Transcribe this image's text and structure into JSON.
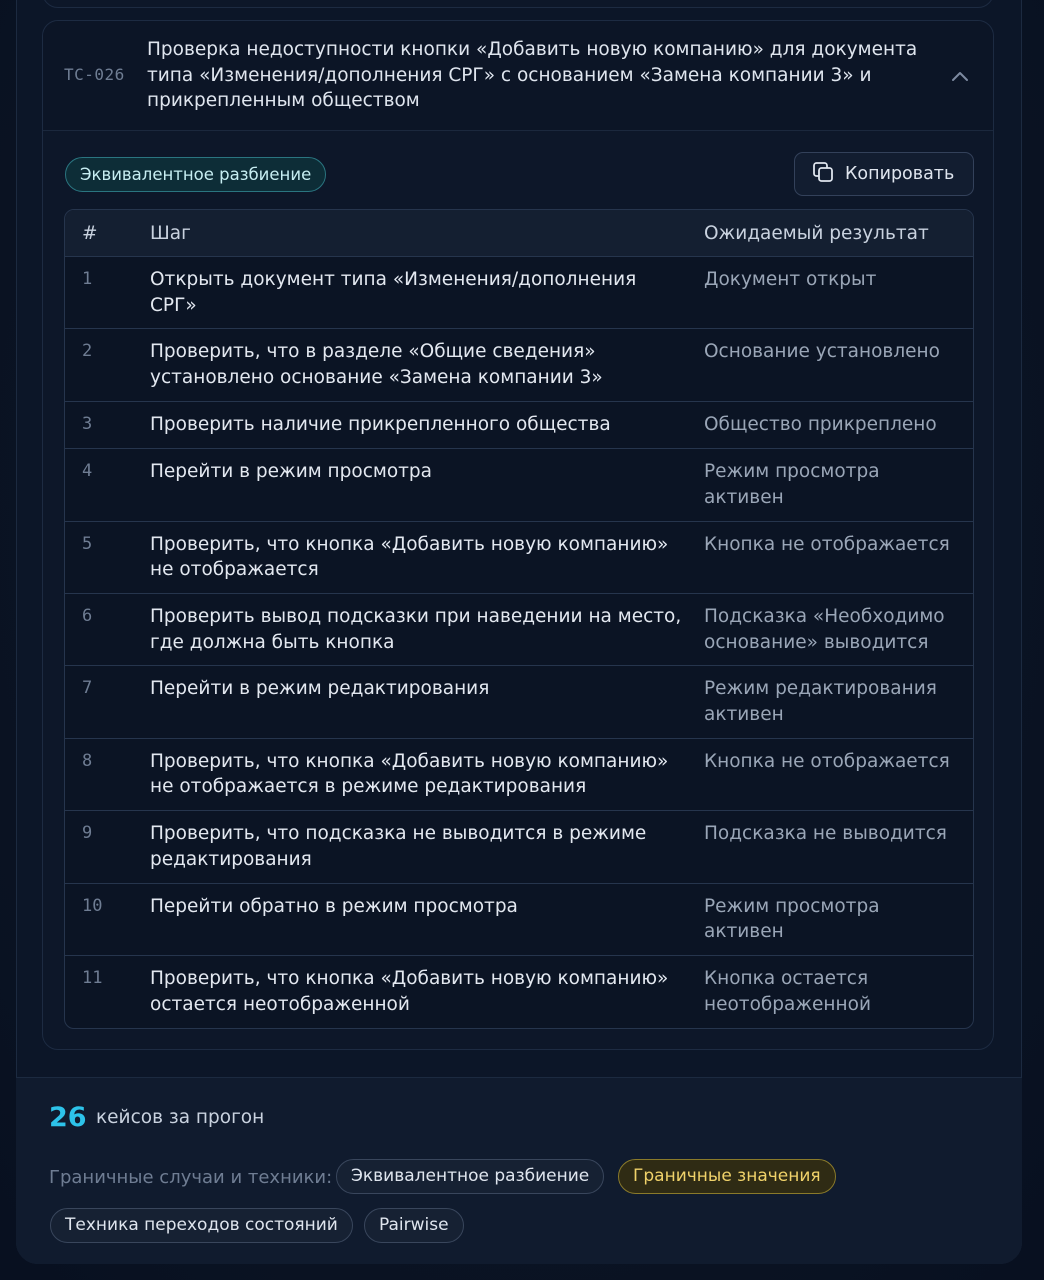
{
  "test_case": {
    "id": "TC-026",
    "title": "Проверка недоступности кнопки «Добавить новую компанию» для документа типа «Изменения/дополнения СРГ» с основанием «Замена компании 3» и прикрепленным обществом",
    "technique_tag": "Эквивалентное разбиение",
    "copy_label": "Копировать",
    "collapse_icon": "chevron-up-icon",
    "copy_icon": "copy-icon"
  },
  "table": {
    "headers": {
      "num": "#",
      "step": "Шаг",
      "expected": "Ожидаемый результат"
    },
    "rows": [
      {
        "num": "1",
        "step": "Открыть документ типа «Изменения/дополнения СРГ»",
        "expected": "Документ открыт"
      },
      {
        "num": "2",
        "step": "Проверить, что в разделе «Общие сведения» установлено основание «Замена компании 3»",
        "expected": "Основание установлено"
      },
      {
        "num": "3",
        "step": "Проверить наличие прикрепленного общества",
        "expected": "Общество прикреплено"
      },
      {
        "num": "4",
        "step": "Перейти в режим просмотра",
        "expected": "Режим просмотра активен"
      },
      {
        "num": "5",
        "step": "Проверить, что кнопка «Добавить новую компанию» не отображается",
        "expected": "Кнопка не отображается"
      },
      {
        "num": "6",
        "step": "Проверить вывод подсказки при наведении на место, где должна быть кнопка",
        "expected": "Подсказка «Необходимо основание» выводится"
      },
      {
        "num": "7",
        "step": "Перейти в режим редактирования",
        "expected": "Режим редактирования активен"
      },
      {
        "num": "8",
        "step": "Проверить, что кнопка «Добавить новую компанию» не отображается в режиме редактирования",
        "expected": "Кнопка не отображается"
      },
      {
        "num": "9",
        "step": "Проверить, что подсказка не выводится в режиме редактирования",
        "expected": "Подсказка не выводится"
      },
      {
        "num": "10",
        "step": "Перейти обратно в режим просмотра",
        "expected": "Режим просмотра активен"
      },
      {
        "num": "11",
        "step": "Проверить, что кнопка «Добавить новую компанию» остается неотображенной",
        "expected": "Кнопка остается неотображенной"
      }
    ]
  },
  "summary": {
    "count": "26",
    "count_label": "кейсов за прогон",
    "techniques_label": "Граничные случаи и техники:",
    "techniques": [
      {
        "label": "Эквивалентное разбиение",
        "style": "default"
      },
      {
        "label": "Граничные значения",
        "style": "warning"
      },
      {
        "label": "Техника переходов состояний",
        "style": "default"
      },
      {
        "label": "Pairwise",
        "style": "default"
      }
    ]
  },
  "colors": {
    "accent": "#2dc3ea",
    "warning": "#f0d26a",
    "tag_teal": "#2a7580",
    "background": "#0b1322"
  }
}
